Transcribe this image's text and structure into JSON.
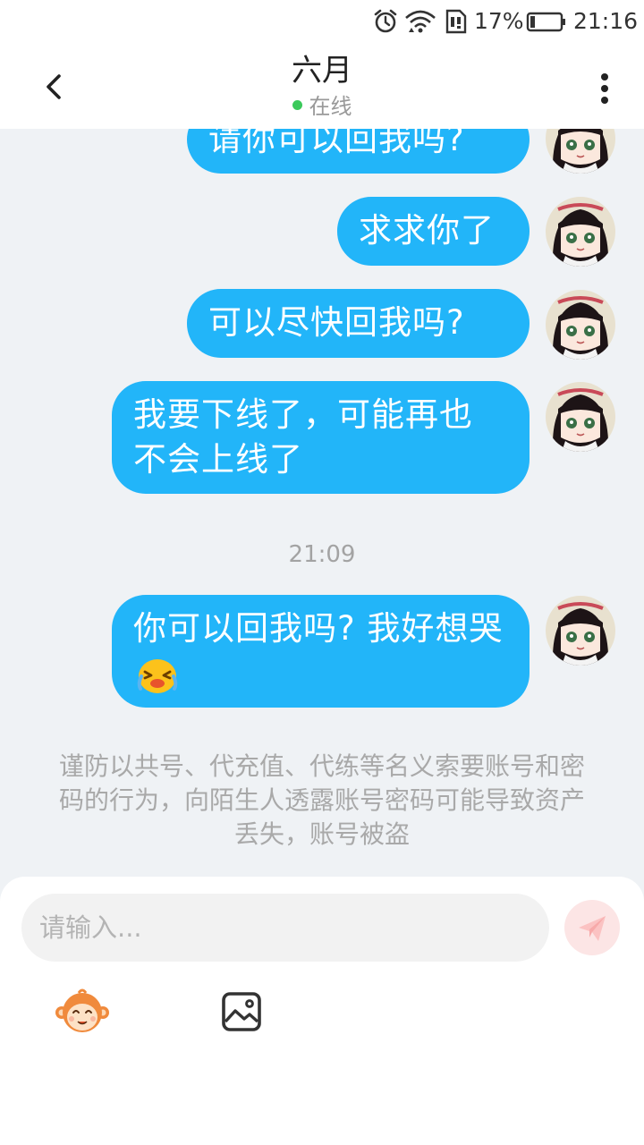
{
  "status_bar": {
    "battery": "17%",
    "time": "21:16"
  },
  "header": {
    "title": "六月",
    "status": "在线"
  },
  "messages": [
    {
      "text": "请你可以回我吗?"
    },
    {
      "text": "求求你了"
    },
    {
      "text": "可以尽快回我吗?"
    },
    {
      "text": "我要下线了，可能再也不会上线了"
    },
    {
      "text": "你可以回我吗? 我好想哭"
    }
  ],
  "timestamp": "21:09",
  "notice": "谨防以共号、代充值、代练等名义索要账号和密码的行为，向陌生人透露账号密码可能导致资产丢失，账号被盗",
  "input": {
    "placeholder": "请输入..."
  },
  "icons": {
    "back": "chevron-left-icon",
    "more": "more-vertical-icon",
    "send": "send-plane-icon",
    "emoji": "monkey-emoji-icon",
    "image": "image-gallery-icon",
    "sob": "crying-emoji-icon"
  },
  "colors": {
    "bubble": "#22b5f9",
    "online_dot": "#3bc95b",
    "send_button_bg": "#fce5e5",
    "send_button_icon": "#fbc2c2"
  }
}
